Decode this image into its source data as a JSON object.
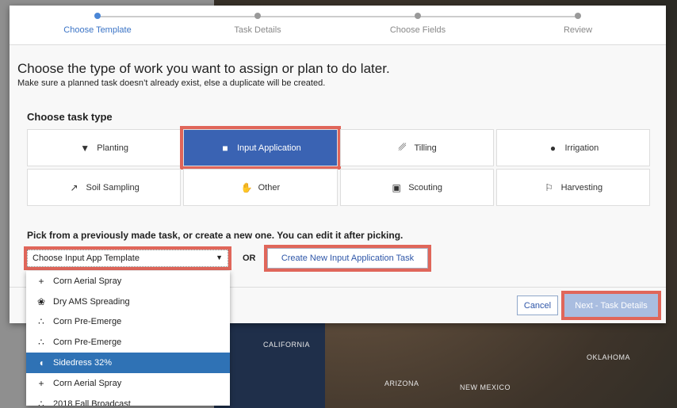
{
  "steps": [
    {
      "label": "Choose Template",
      "active": true
    },
    {
      "label": "Task Details"
    },
    {
      "label": "Choose Fields"
    },
    {
      "label": "Review"
    }
  ],
  "title": "Choose the type of work you want to assign or plan to do later.",
  "subtitle": "Make sure a planned task doesn’t already exist, else a duplicate will be created.",
  "task_type_heading": "Choose task type",
  "task_types": [
    {
      "label": "Planting",
      "icon": "seed-bag-icon",
      "glyph": "▼"
    },
    {
      "label": "Input Application",
      "icon": "jug-icon",
      "glyph": "■",
      "selected": true
    },
    {
      "label": "Tilling",
      "icon": "tilling-icon",
      "glyph": "␥"
    },
    {
      "label": "Irrigation",
      "icon": "droplet-icon",
      "glyph": "●"
    },
    {
      "label": "Soil Sampling",
      "icon": "probe-icon",
      "glyph": "↗"
    },
    {
      "label": "Other",
      "icon": "hand-icon",
      "glyph": "✋"
    },
    {
      "label": "Scouting",
      "icon": "camera-icon",
      "glyph": "▣"
    },
    {
      "label": "Harvesting",
      "icon": "harvester-icon",
      "glyph": "⚐"
    }
  ],
  "pick_heading": "Pick from a previously made task, or create a new one. You can edit it after picking.",
  "template_select": {
    "value": "Choose Input App Template"
  },
  "or_label": "OR",
  "create_button": "Create New Input Application Task",
  "cancel_button": "Cancel",
  "next_button": "Next - Task Details",
  "dropdown_options": [
    {
      "label": "Corn Aerial Spray",
      "glyph": "+"
    },
    {
      "label": "Dry AMS Spreading",
      "glyph": "❀"
    },
    {
      "label": "Corn Pre-Emerge",
      "glyph": "∴"
    },
    {
      "label": "Corn Pre-Emerge",
      "glyph": "∴"
    },
    {
      "label": "Sidedress 32%",
      "glyph": "◖",
      "highlighted": true
    },
    {
      "label": "Corn Aerial Spray",
      "glyph": "+"
    },
    {
      "label": "2018 Fall Broadcast",
      "glyph": "∴"
    }
  ],
  "map_labels": [
    "CALIFORNIA",
    "ARIZONA",
    "NEW MEXICO",
    "OKLAHOMA"
  ],
  "colors": {
    "accent": "#3a63b3",
    "highlight": "#e0665a",
    "active_step": "#3b74c6"
  }
}
